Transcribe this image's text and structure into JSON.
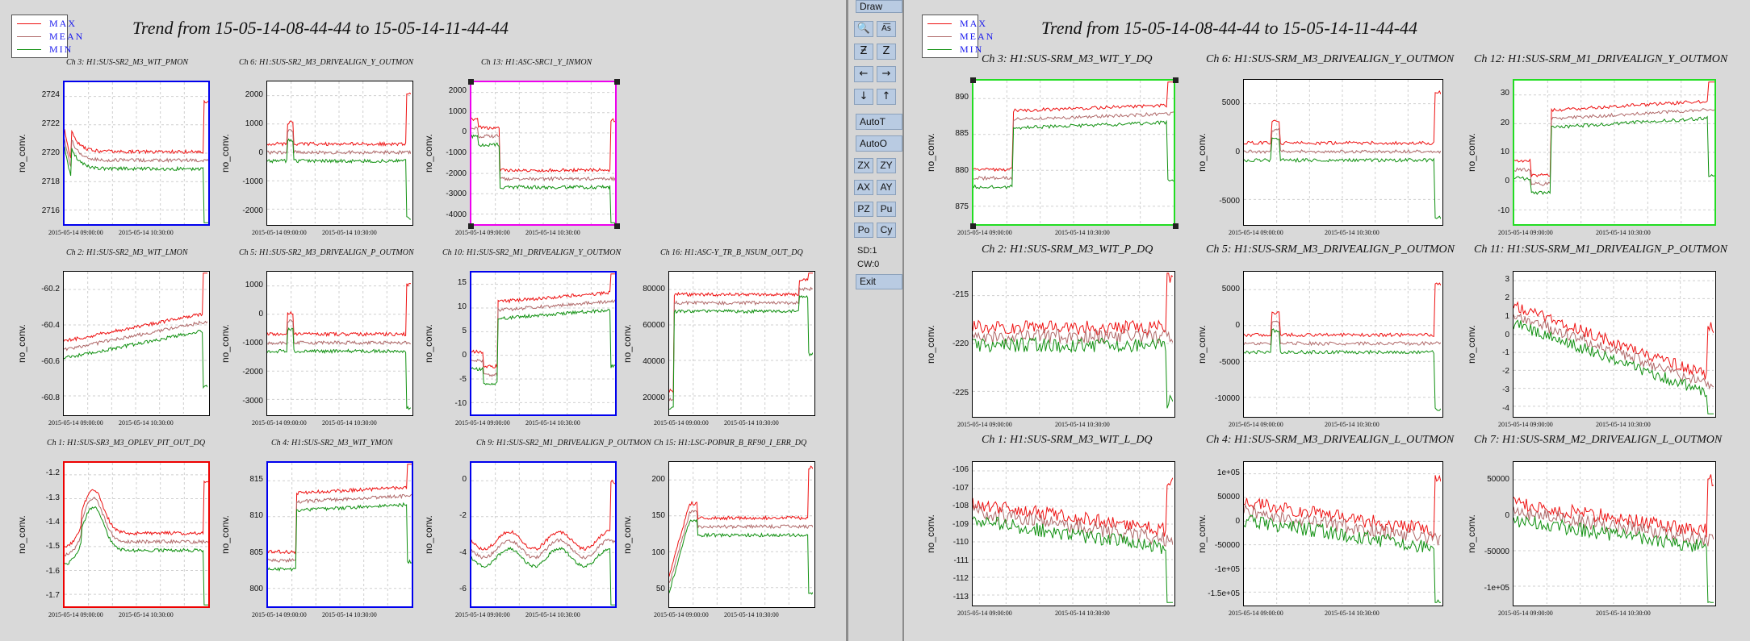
{
  "colors": {
    "max": "#ee1111",
    "mean": "#b06a6a",
    "min": "#109010",
    "plot_bg": "#ffffff",
    "grid": "#cfcfcf",
    "frame_blue": "#0000ee",
    "frame_red": "#ee0000",
    "frame_magenta": "#ee00ee",
    "frame_green": "#22dd22",
    "frame_black": "#000000"
  },
  "legend": {
    "max": "MAX",
    "mean": "MEAN",
    "min": "MIN"
  },
  "left": {
    "title": "Trend from 15-05-14-08-44-44 to 15-05-14-11-44-44",
    "charts": [
      {
        "label": "Ch 3: H1:SUS-SR2_M3_WIT_PMON",
        "frame": "frame_blue",
        "yticks": [
          "2724",
          "2722",
          "2720",
          "2718",
          "2716"
        ],
        "ylabel": "no_conv.",
        "xticks": [
          "2015-05-14 09:00:00",
          "2015-05-14 10:30:00"
        ],
        "shape": "decay"
      },
      {
        "label": "Ch 6: H1:SUS-SR2_M3_DRIVEALIGN_Y_OUTMON",
        "frame": "frame_black",
        "yticks": [
          "2000",
          "1000",
          "0",
          "-1000",
          "-2000"
        ],
        "ylabel": "no_conv.",
        "xticks": [
          "2015-05-14 09:00:00",
          "2015-05-14 10:30:00"
        ],
        "shape": "flatspike"
      },
      {
        "label": "Ch 13: H1:ASC-SRC1_Y_INMON",
        "frame": "frame_magenta",
        "yticks": [
          "2000",
          "1000",
          "0",
          "-1000",
          "-2000",
          "-3000",
          "-4000"
        ],
        "ylabel": "no_conv.",
        "xticks": [
          "2015-05-14 09:00:00",
          "2015-05-14 10:30:00"
        ],
        "shape": "stepdown"
      },
      {
        "label": "Ch 2: H1:SUS-SR2_M3_WIT_LMON",
        "frame": "frame_black",
        "yticks": [
          "-60.2",
          "-60.4",
          "-60.6",
          "-60.8"
        ],
        "ylabel": "no_conv.",
        "xticks": [
          "2015-05-14 09:00:00",
          "2015-05-14 10:30:00"
        ],
        "shape": "rise"
      },
      {
        "label": "Ch 5: H1:SUS-SR2_M3_DRIVEALIGN_P_OUTMON",
        "frame": "frame_black",
        "yticks": [
          "1000",
          "0",
          "-1000",
          "-2000",
          "-3000"
        ],
        "ylabel": "no_conv.",
        "xticks": [
          "2015-05-14 09:00:00",
          "2015-05-14 10:30:00"
        ],
        "shape": "flatspike"
      },
      {
        "label": "Ch 10: H1:SUS-SR2_M1_DRIVEALIGN_Y_OUTMON",
        "frame": "frame_blue",
        "yticks": [
          "15",
          "10",
          "5",
          "0",
          "-5",
          "-10"
        ],
        "ylabel": "no_conv.",
        "xticks": [
          "2015-05-14 09:00:00",
          "2015-05-14 10:30:00"
        ],
        "shape": "stepup"
      },
      {
        "label": "Ch 16: H1:ASC-Y_TR_B_NSUM_OUT_DQ",
        "frame": "frame_black",
        "yticks": [
          "80000",
          "60000",
          "40000",
          "20000"
        ],
        "ylabel": "no_conv.",
        "xticks": [
          "2015-05-14 09:00:00",
          "2015-05-14 10:30:00"
        ],
        "shape": "plateau"
      },
      {
        "label": "Ch 1: H1:SUS-SR3_M3_OPLEV_PIT_OUT_DQ",
        "frame": "frame_red",
        "yticks": [
          "-1.2",
          "-1.3",
          "-1.4",
          "-1.5",
          "-1.6",
          "-1.7"
        ],
        "ylabel": "no_conv.",
        "xticks": [
          "2015-05-14 09:00:00",
          "2015-05-14 10:30:00"
        ],
        "shape": "hump"
      },
      {
        "label": "Ch 4: H1:SUS-SR2_M3_WIT_YMON",
        "frame": "frame_blue",
        "yticks": [
          "815",
          "810",
          "805",
          "800"
        ],
        "ylabel": "no_conv.",
        "xticks": [
          "2015-05-14 09:00:00",
          "2015-05-14 10:30:00"
        ],
        "shape": "stepup2"
      },
      {
        "label": "Ch 9: H1:SUS-SR2_M1_DRIVEALIGN_P_OUTMON",
        "frame": "frame_blue",
        "yticks": [
          "0",
          "-2",
          "-4",
          "-6"
        ],
        "ylabel": "no_conv.",
        "xticks": [
          "2015-05-14 09:00:00",
          "2015-05-14 10:30:00"
        ],
        "shape": "wavy"
      },
      {
        "label": "Ch 15: H1:LSC-POPAIR_B_RF90_I_ERR_DQ",
        "frame": "frame_black",
        "yticks": [
          "200",
          "150",
          "100",
          "50"
        ],
        "ylabel": "no_conv.",
        "xticks": [
          "2015-05-14 09:00:00",
          "2015-05-14 10:30:00"
        ],
        "shape": "peakplateau"
      }
    ]
  },
  "right": {
    "title": "Trend from 15-05-14-08-44-44 to 15-05-14-11-44-44",
    "charts": [
      {
        "label": "Ch 3: H1:SUS-SRM_M3_WIT_Y_DQ",
        "frame": "frame_green",
        "yticks": [
          "890",
          "885",
          "880",
          "875"
        ],
        "ylabel": "no_conv.",
        "xticks": [
          "2015-05-14 09:00:00",
          "2015-05-14 10:30:00"
        ],
        "shape": "stepup2"
      },
      {
        "label": "Ch 6: H1:SUS-SRM_M3_DRIVEALIGN_Y_OUTMON",
        "frame": "frame_black",
        "yticks": [
          "5000",
          "0",
          "-5000"
        ],
        "ylabel": "no_conv.",
        "xticks": [
          "2015-05-14 09:00:00",
          "2015-05-14 10:30:00"
        ],
        "shape": "flatspike"
      },
      {
        "label": "Ch 12: H1:SUS-SRM_M1_DRIVEALIGN_Y_OUTMON",
        "frame": "frame_green",
        "yticks": [
          "30",
          "20",
          "10",
          "0",
          "-10"
        ],
        "ylabel": "no_conv.",
        "xticks": [
          "2015-05-14 09:00:00",
          "2015-05-14 10:30:00"
        ],
        "shape": "stepup"
      },
      {
        "label": "Ch 2: H1:SUS-SRM_M3_WIT_P_DQ",
        "frame": "frame_black",
        "yticks": [
          "-215",
          "-220",
          "-225"
        ],
        "ylabel": "no_conv.",
        "xticks": [
          "2015-05-14 09:00:00",
          "2015-05-14 10:30:00"
        ],
        "shape": "noisyflat"
      },
      {
        "label": "Ch 5: H1:SUS-SRM_M3_DRIVEALIGN_P_OUTMON",
        "frame": "frame_black",
        "yticks": [
          "5000",
          "0",
          "-5000",
          "-10000"
        ],
        "ylabel": "no_conv.",
        "xticks": [
          "2015-05-14 09:00:00",
          "2015-05-14 10:30:00"
        ],
        "shape": "flatspike"
      },
      {
        "label": "Ch 11: H1:SUS-SRM_M1_DRIVEALIGN_P_OUTMON",
        "frame": "frame_black",
        "yticks": [
          "3",
          "2",
          "1",
          "0",
          "-1",
          "-2",
          "-3",
          "-4"
        ],
        "ylabel": "no_conv.",
        "xticks": [
          "2015-05-14 09:00:00",
          "2015-05-14 10:30:00"
        ],
        "shape": "decline"
      },
      {
        "label": "Ch 1: H1:SUS-SRM_M3_WIT_L_DQ",
        "frame": "frame_black",
        "yticks": [
          "-106",
          "-107",
          "-108",
          "-109",
          "-110",
          "-111",
          "-112",
          "-113"
        ],
        "ylabel": "no_conv.",
        "xticks": [
          "2015-05-14 09:00:00",
          "2015-05-14 10:30:00"
        ],
        "shape": "noisydecline"
      },
      {
        "label": "Ch 4: H1:SUS-SRM_M3_DRIVEALIGN_L_OUTMON",
        "frame": "frame_black",
        "yticks": [
          "1e+05",
          "50000",
          "0",
          "-50000",
          "-1e+05",
          "-1.5e+05"
        ],
        "ylabel": "no_conv.",
        "xticks": [
          "2015-05-14 09:00:00",
          "2015-05-14 10:30:00"
        ],
        "shape": "noisydecline"
      },
      {
        "label": "Ch 7: H1:SUS-SRM_M2_DRIVEALIGN_L_OUTMON",
        "frame": "frame_black",
        "yticks": [
          "50000",
          "0",
          "-50000",
          "-1e+05"
        ],
        "ylabel": "no_conv.",
        "xticks": [
          "2015-05-14 09:00:00",
          "2015-05-14 10:30:00"
        ],
        "shape": "noisydecline"
      }
    ]
  },
  "toolbar": {
    "draw": "Draw",
    "autot": "AutoT",
    "autoo": "AutoO",
    "zx": "ZX",
    "zy": "ZY",
    "ax": "AX",
    "ay": "AY",
    "pz": "PZ",
    "pu": "Pu",
    "po": "Po",
    "cy": "Cy",
    "sd": "SD:1",
    "cw": "CW:0",
    "exit": "Exit",
    "icons": [
      "magnifier-icon",
      "magnifier-abc-icon",
      "zoom-z-slash-icon",
      "zoom-z-icon",
      "arrow-left-icon",
      "arrow-right-icon",
      "arrow-down-icon",
      "arrow-up-icon"
    ]
  }
}
